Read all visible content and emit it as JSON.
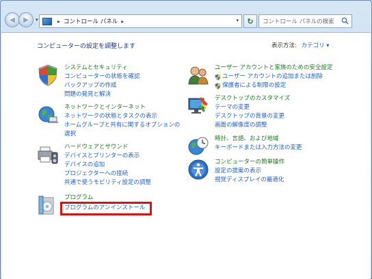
{
  "address": {
    "path_root": "コントロール パネル",
    "search_placeholder": "コントロール パネルの検索"
  },
  "main": {
    "heading": "コンピューターの設定を調整します",
    "view_by_label": "表示方法:",
    "view_by_value": "カテゴリ"
  },
  "left_categories": [
    {
      "title": "システムとセキュリティ",
      "items": [
        "コンピューターの状態を確認",
        "バックアップの作成",
        "問題の発見と解決"
      ]
    },
    {
      "title": "ネットワークとインターネット",
      "items": [
        "ネットワークの状態とタスクの表示",
        "ホームグループと共有に関するオプションの",
        "選択"
      ]
    },
    {
      "title": "ハードウェアとサウンド",
      "items": [
        "デバイスとプリンターの表示",
        "デバイスの追加",
        "プロジェクターへの接続",
        "共通で使うモビリティ設定の調整"
      ]
    },
    {
      "title": "プログラム",
      "items": [
        "プログラムのアンインストール"
      ]
    }
  ],
  "right_categories": [
    {
      "title": "ユーザー アカウントと家族のための安全設定",
      "items": [
        "ユーザー アカウントの追加または削除",
        "保護者による制限の設定"
      ]
    },
    {
      "title": "デスクトップのカスタマイズ",
      "items": [
        "テーマの変更",
        "デスクトップの背景の変更",
        "画面の解像度の調整"
      ]
    },
    {
      "title": "時計、言語、および地域",
      "items": [
        "キーボードまたは入力方法の変更"
      ]
    },
    {
      "title": "コンピューターの簡単操作",
      "items": [
        "設定の提案の表示",
        "視覚ディスプレイの最適化"
      ]
    }
  ],
  "colors": {
    "category_title": "#1a7a1a",
    "link": "#1d5fd1",
    "heading": "#1e3287",
    "highlight": "#e01010"
  }
}
